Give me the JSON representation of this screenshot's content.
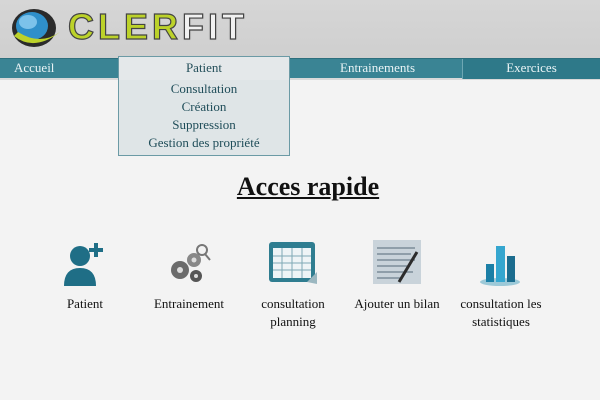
{
  "app": {
    "name_part1": "CLER",
    "name_part2": "FIT"
  },
  "nav": {
    "items": [
      "Accueil",
      "Patient",
      "Entrainements",
      "Exercices"
    ]
  },
  "dropdown": {
    "items": [
      "Consultation",
      "Création",
      "Suppression",
      "Gestion des propriété"
    ]
  },
  "main": {
    "title": "Acces rapide",
    "quick_access": [
      {
        "label": "Patient",
        "icon": "patient-icon"
      },
      {
        "label": "Entrainement",
        "icon": "gears-icon"
      },
      {
        "label": "consultation planning",
        "icon": "calendar-icon"
      },
      {
        "label": "Ajouter un bilan",
        "icon": "document-icon"
      },
      {
        "label": "consultation les statistiques",
        "icon": "bar-chart-icon"
      }
    ]
  },
  "colors": {
    "nav": "#3a8494",
    "accent": "#bcd22a",
    "header": "#d3d3d3"
  }
}
